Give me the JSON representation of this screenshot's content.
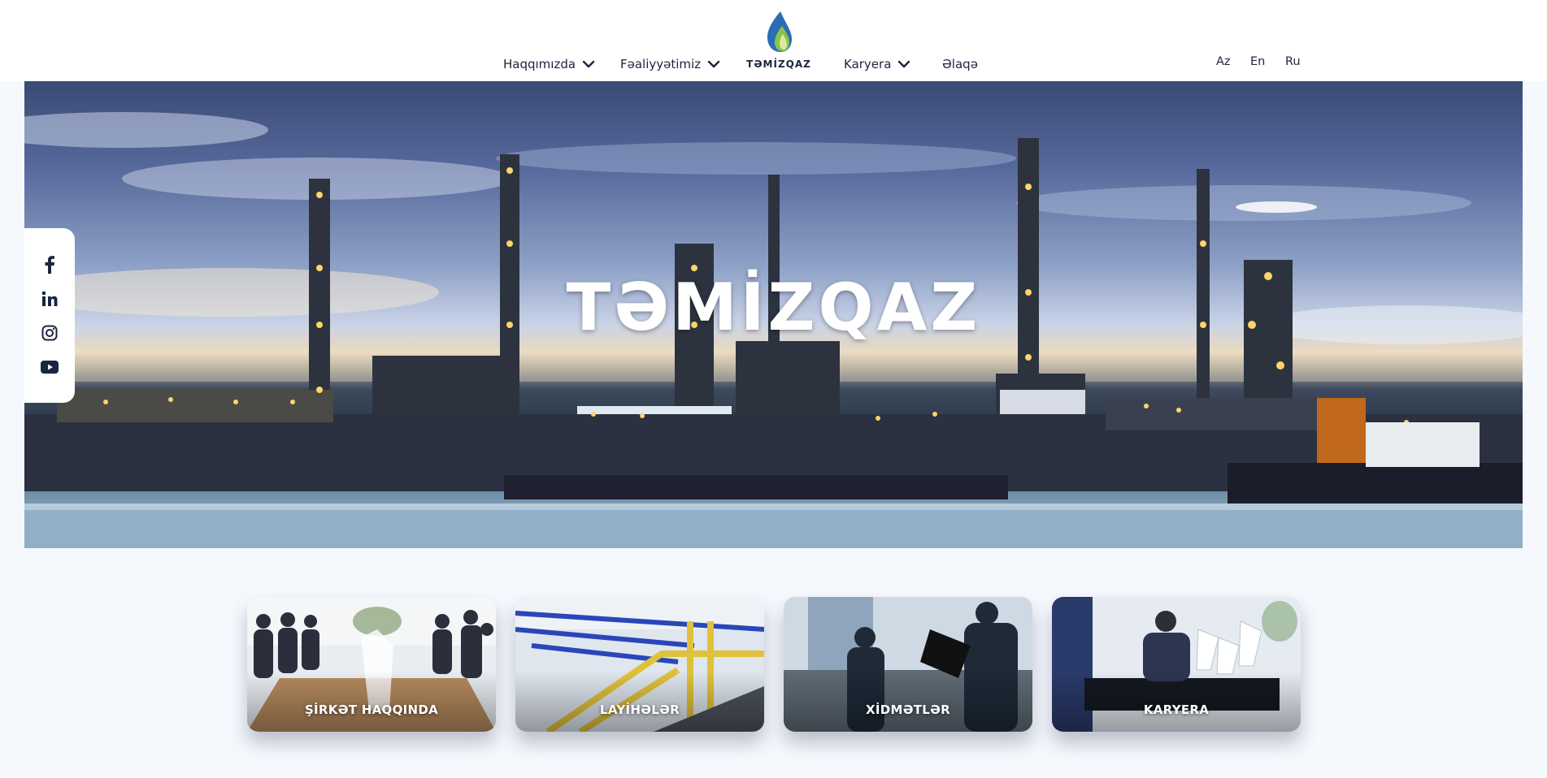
{
  "header": {
    "nav_left": [
      {
        "label": "Haqqımızda",
        "has_dropdown": true
      },
      {
        "label": "Fəaliyyətimiz",
        "has_dropdown": true
      }
    ],
    "logo_text": "TƏMİZQAZ",
    "nav_right": [
      {
        "label": "Karyera",
        "has_dropdown": true
      },
      {
        "label": "Əlaqə",
        "has_dropdown": false
      }
    ],
    "languages": [
      "Az",
      "En",
      "Ru"
    ]
  },
  "hero": {
    "title": "TƏMİZQAZ"
  },
  "social": [
    {
      "icon": "facebook-icon"
    },
    {
      "icon": "linkedin-icon"
    },
    {
      "icon": "instagram-icon"
    },
    {
      "icon": "youtube-icon"
    }
  ],
  "cards": [
    {
      "label": "ŞİRKƏT HAQQINDA",
      "image": "business-meeting"
    },
    {
      "label": "LAYİHƏLƏR",
      "image": "industrial-pipelines"
    },
    {
      "label": "XİDMƏTLƏR",
      "image": "workers-laptop"
    },
    {
      "label": "KARYERA",
      "image": "office-desk-flags"
    }
  ],
  "colors": {
    "text": "#1a2540",
    "header_bg": "#ffffff",
    "page_bg": "#f5f8fd",
    "logo_blue": "#2b6cb5",
    "logo_green": "#8bc34a"
  }
}
